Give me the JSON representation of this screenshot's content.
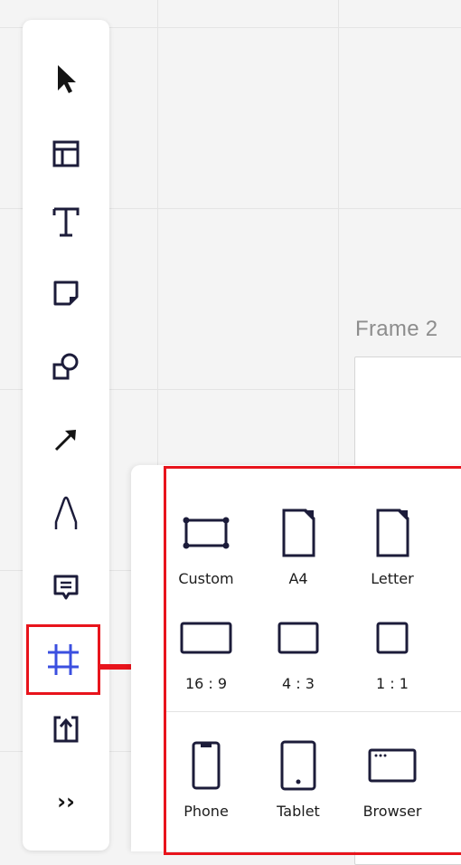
{
  "canvas": {
    "frame_label": "Frame 2"
  },
  "toolbar": {
    "tools": [
      {
        "name": "select",
        "icon": "cursor-icon"
      },
      {
        "name": "templates",
        "icon": "layout-icon"
      },
      {
        "name": "text",
        "icon": "text-icon"
      },
      {
        "name": "sticky-note",
        "icon": "sticky-note-icon"
      },
      {
        "name": "shapes",
        "icon": "shapes-icon"
      },
      {
        "name": "connection-line",
        "icon": "arrow-icon"
      },
      {
        "name": "pen",
        "icon": "pen-icon"
      },
      {
        "name": "comment",
        "icon": "comment-icon"
      },
      {
        "name": "frame",
        "icon": "frame-icon",
        "active": true
      },
      {
        "name": "upload",
        "icon": "upload-icon"
      }
    ],
    "more_label": "››"
  },
  "frame_panel": {
    "items": [
      {
        "label": "Custom",
        "icon": "custom-frame-icon"
      },
      {
        "label": "A4",
        "icon": "a4-page-icon"
      },
      {
        "label": "Letter",
        "icon": "letter-page-icon"
      },
      {
        "label": "16 : 9",
        "icon": "ratio-16-9-icon"
      },
      {
        "label": "4 : 3",
        "icon": "ratio-4-3-icon"
      },
      {
        "label": "1 : 1",
        "icon": "ratio-1-1-icon"
      },
      {
        "label": "Phone",
        "icon": "phone-icon"
      },
      {
        "label": "Tablet",
        "icon": "tablet-icon"
      },
      {
        "label": "Browser",
        "icon": "browser-icon"
      }
    ]
  },
  "annotation": {
    "highlight_color": "#e8141c"
  },
  "colors": {
    "icon": "#1c1c3a",
    "active_icon": "#3b4fe0",
    "canvas": "#f4f4f4"
  }
}
